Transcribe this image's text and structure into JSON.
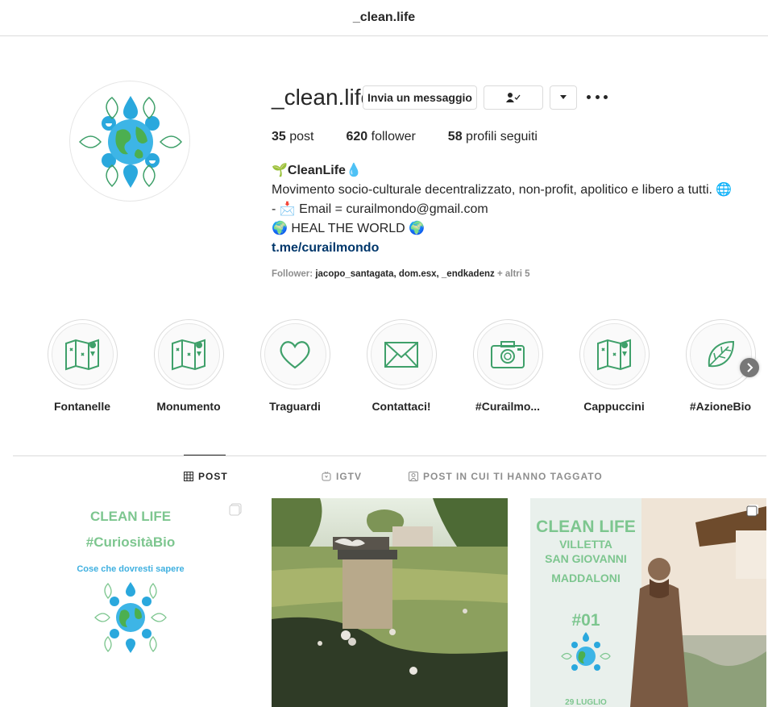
{
  "topbar": {
    "title": "_clean.life"
  },
  "profile": {
    "username": "_clean.life",
    "message_button": "Invia un messaggio",
    "stats": {
      "posts_count": "35",
      "posts_label": "post",
      "followers_count": "620",
      "followers_label": "follower",
      "following_count": "58",
      "following_label": "profili seguiti"
    },
    "bio": {
      "name": "🌱CleanLife💧",
      "line1": "Movimento socio-culturale decentralizzato, non-profit, apolitico e libero a tutti. 🌐",
      "line2": "- 📩 Email = curailmondo@gmail.com",
      "line3": "🌍 HEAL THE WORLD 🌍",
      "link": "t.me/curailmondo"
    },
    "followed_by": {
      "prefix": "Follower:",
      "names": "jacopo_santagata, dom.esx, _endkadenz",
      "suffix": "+ altri 5"
    }
  },
  "highlights": [
    {
      "label": "Fontanelle",
      "icon": "map-icon"
    },
    {
      "label": "Monumento",
      "icon": "map-icon"
    },
    {
      "label": "Traguardi",
      "icon": "heart-icon"
    },
    {
      "label": "Contattaci!",
      "icon": "envelope-icon"
    },
    {
      "label": "#Curailmo...",
      "icon": "camera-icon"
    },
    {
      "label": "Cappuccini",
      "icon": "map-icon"
    },
    {
      "label": "#AzioneBio",
      "icon": "leaf-icon"
    }
  ],
  "tabs": [
    {
      "label": "POST",
      "icon": "grid-icon",
      "active": true
    },
    {
      "label": "IGTV",
      "icon": "igtv-icon",
      "active": false
    },
    {
      "label": "POST IN CUI TI HANNO TAGGATO",
      "icon": "tagged-icon",
      "active": false
    }
  ],
  "posts": {
    "post1": {
      "title": "CLEAN LIFE",
      "tag": "#CuriositàBio",
      "subtitle": "Cose che dovresti sapere"
    },
    "post3": {
      "title": "CLEAN LIFE",
      "line1": "VILLETTA",
      "line2": "SAN GIOVANNI",
      "line3": "MADDALONI",
      "number": "#01",
      "date": "29 LUGLIO"
    }
  },
  "colors": {
    "accent": "#3fa06a",
    "link": "#00376b",
    "muted": "#8e8e8e",
    "water": "#2aa8dd"
  }
}
